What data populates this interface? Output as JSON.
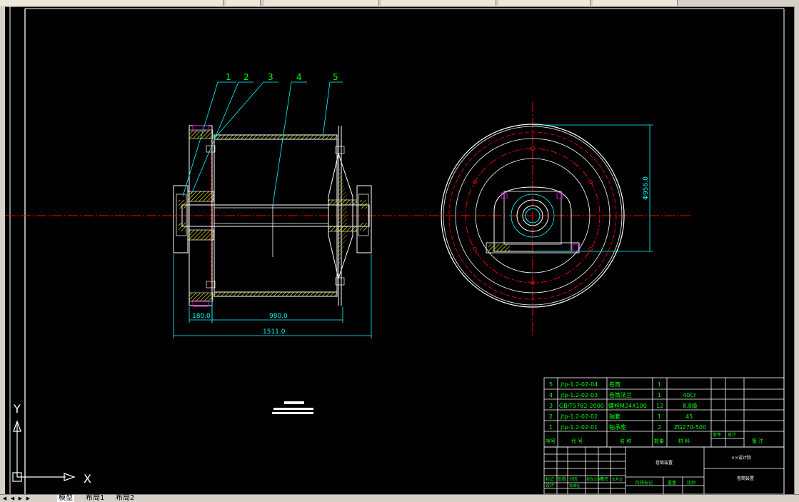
{
  "drawing": {
    "callouts": [
      "1",
      "2",
      "3",
      "4",
      "5"
    ],
    "dims": {
      "flange_width": "180.0",
      "drum_length": "980.0",
      "overall_length": "1511.0",
      "diameter": "Φ956.0"
    }
  },
  "parts_table": {
    "rows": [
      {
        "no": "5",
        "code": "jtp-1.2-02-04",
        "name": "卷筒",
        "qty": "1",
        "material": "",
        "note": ""
      },
      {
        "no": "4",
        "code": "jtp-1.2-02-03",
        "name": "卷筒法兰",
        "qty": "1",
        "material": "40Cr",
        "note": ""
      },
      {
        "no": "3",
        "code": "GB/T5782-2000",
        "name": "螺栓M24X100",
        "qty": "12",
        "material": "8.8级",
        "note": ""
      },
      {
        "no": "2",
        "code": "jtp-1.2-02-02",
        "name": "轴套",
        "qty": "1",
        "material": "45",
        "note": ""
      },
      {
        "no": "1",
        "code": "jtp-1.2-02-01",
        "name": "轴承座",
        "qty": "2",
        "material": "ZG270-500",
        "note": ""
      }
    ],
    "header": {
      "no": "序号",
      "code": "代  号",
      "name": "名  称",
      "qty": "数量",
      "material": "材  料",
      "w1": "单件",
      "w2": "总计",
      "note": "备  注"
    }
  },
  "title_block": {
    "drawing_name": "卷筒装置",
    "company": "××设计院",
    "title": "卷筒装置",
    "scale": "1:10",
    "row_labels": [
      "标记",
      "处数",
      "分区",
      "更改文件号",
      "签名",
      "年月日"
    ],
    "sig_labels": [
      "设计",
      "标准化",
      "审核",
      "工艺",
      "批准"
    ],
    "misc": [
      "阶段标记",
      "重量",
      "比例",
      "共 张",
      "第 张"
    ]
  },
  "ucs": {
    "x": "X",
    "y": "Y"
  },
  "tabs": {
    "model": "模型",
    "layout1": "布局1",
    "layout2": "布局2"
  },
  "colors": {
    "background": "#000000",
    "white": "#ffffff",
    "cyan": "#00ffff",
    "green": "#00ff00",
    "yellow": "#ffff00",
    "red": "#ff0000",
    "magenta": "#ff00ff"
  }
}
